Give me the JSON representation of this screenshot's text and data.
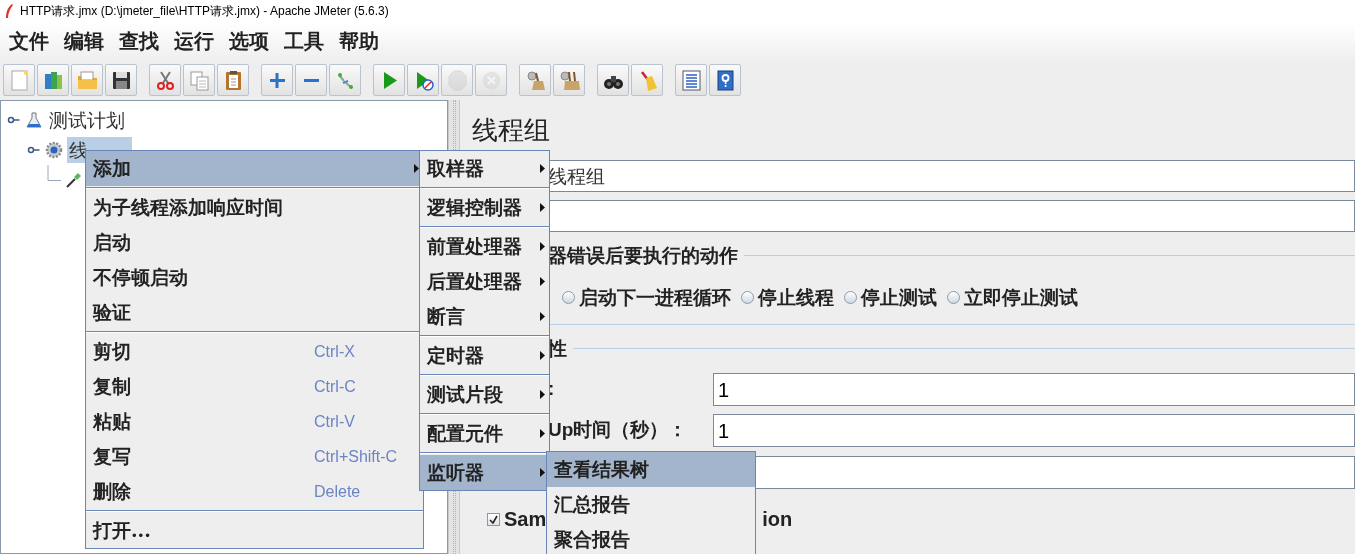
{
  "window": {
    "title": "HTTP请求.jmx (D:\\jmeter_file\\HTTP请求.jmx) - Apache JMeter (5.6.3)"
  },
  "menu_bar": [
    "文件",
    "编辑",
    "查找",
    "运行",
    "选项",
    "工具",
    "帮助"
  ],
  "toolbar": [
    {
      "buttons": [
        {
          "disabled": false
        },
        {
          "disabled": false
        },
        {
          "disabled": false
        },
        {
          "disabled": false
        }
      ]
    },
    {
      "buttons": [
        {
          "disabled": false
        },
        {
          "disabled": false
        },
        {
          "disabled": false
        }
      ]
    },
    {
      "buttons": [
        {
          "disabled": false
        },
        {
          "disabled": false
        },
        {
          "disabled": false
        }
      ]
    },
    {
      "buttons": [
        {
          "disabled": false
        },
        {
          "disabled": false
        },
        {
          "disabled": true
        },
        {
          "disabled": true
        }
      ]
    },
    {
      "buttons": [
        {
          "disabled": false
        },
        {
          "disabled": false
        }
      ]
    },
    {
      "buttons": [
        {
          "disabled": false
        },
        {
          "disabled": false
        }
      ]
    },
    {
      "buttons": [
        {
          "disabled": false
        },
        {
          "disabled": false
        }
      ]
    }
  ],
  "tree": [
    {
      "kind": "plan",
      "label": "测试计划",
      "selected": false,
      "children": [
        {
          "kind": "group",
          "label": "线",
          "selected": true,
          "children": [
            {
              "kind": "sampler",
              "selected": false
            }
          ]
        }
      ]
    }
  ],
  "panel": {
    "title": "线程组",
    "name_value": "线程组",
    "error_action": {
      "title": "器错误后要执行的动作",
      "options": [
        {
          "label": "启动下一进程循环",
          "selected": false
        },
        {
          "label": "停止线程",
          "selected": false
        },
        {
          "label": "停止测试",
          "selected": false
        },
        {
          "label": "立即停止测试",
          "selected": false
        }
      ]
    },
    "properties": {
      "title": "性",
      "fields": [
        {
          "label": ":",
          "value": "1"
        },
        {
          "label": "Up时间（秒）：",
          "value": "1"
        }
      ]
    },
    "checkbox": {
      "label_start": "Sam",
      "label_end": "ion",
      "checked": true
    }
  },
  "context_menu": {
    "items": [
      {
        "kind": "item",
        "label": "添加",
        "submenu": true,
        "selected": true
      },
      {
        "kind": "separator"
      },
      {
        "kind": "item",
        "label": "为子线程添加响应时间",
        "submenu": false,
        "selected": false
      },
      {
        "kind": "item",
        "label": "启动",
        "submenu": false,
        "selected": false
      },
      {
        "kind": "item",
        "label": "不停顿启动",
        "submenu": false,
        "selected": false
      },
      {
        "kind": "item",
        "label": "验证",
        "submenu": false,
        "selected": false
      },
      {
        "kind": "separator"
      },
      {
        "kind": "item",
        "label": "剪切",
        "shortcut": "Ctrl-X",
        "submenu": false,
        "selected": false
      },
      {
        "kind": "item",
        "label": "复制",
        "shortcut": "Ctrl-C",
        "submenu": false,
        "selected": false
      },
      {
        "kind": "item",
        "label": "粘贴",
        "shortcut": "Ctrl-V",
        "submenu": false,
        "selected": false
      },
      {
        "kind": "item",
        "label": "复写",
        "shortcut": "Ctrl+Shift-C",
        "submenu": false,
        "selected": false
      },
      {
        "kind": "item",
        "label": "删除",
        "shortcut": "Delete",
        "submenu": false,
        "selected": false
      },
      {
        "kind": "separator"
      },
      {
        "kind": "item",
        "label": "打开...",
        "submenu": false,
        "selected": false
      }
    ]
  },
  "add_submenu": {
    "items": [
      {
        "kind": "item",
        "label": "取样器",
        "submenu": true,
        "selected": false
      },
      {
        "kind": "separator"
      },
      {
        "kind": "item",
        "label": "逻辑控制器",
        "submenu": true,
        "selected": false
      },
      {
        "kind": "separator"
      },
      {
        "kind": "item",
        "label": "前置处理器",
        "submenu": true,
        "selected": false
      },
      {
        "kind": "item",
        "label": "后置处理器",
        "submenu": true,
        "selected": false
      },
      {
        "kind": "item",
        "label": "断言",
        "submenu": true,
        "selected": false
      },
      {
        "kind": "separator"
      },
      {
        "kind": "item",
        "label": "定时器",
        "submenu": true,
        "selected": false
      },
      {
        "kind": "separator"
      },
      {
        "kind": "item",
        "label": "测试片段",
        "submenu": true,
        "selected": false
      },
      {
        "kind": "separator"
      },
      {
        "kind": "item",
        "label": "配置元件",
        "submenu": true,
        "selected": false
      },
      {
        "kind": "separator"
      },
      {
        "kind": "item",
        "label": "监听器",
        "submenu": true,
        "selected": true
      }
    ]
  },
  "listener_submenu": {
    "items": [
      {
        "kind": "item",
        "label": "查看结果树",
        "submenu": false,
        "selected": true
      },
      {
        "kind": "item",
        "label": "汇总报告",
        "submenu": false,
        "selected": false
      },
      {
        "kind": "item",
        "label": "聚合报告",
        "submenu": false,
        "selected": false
      }
    ]
  }
}
